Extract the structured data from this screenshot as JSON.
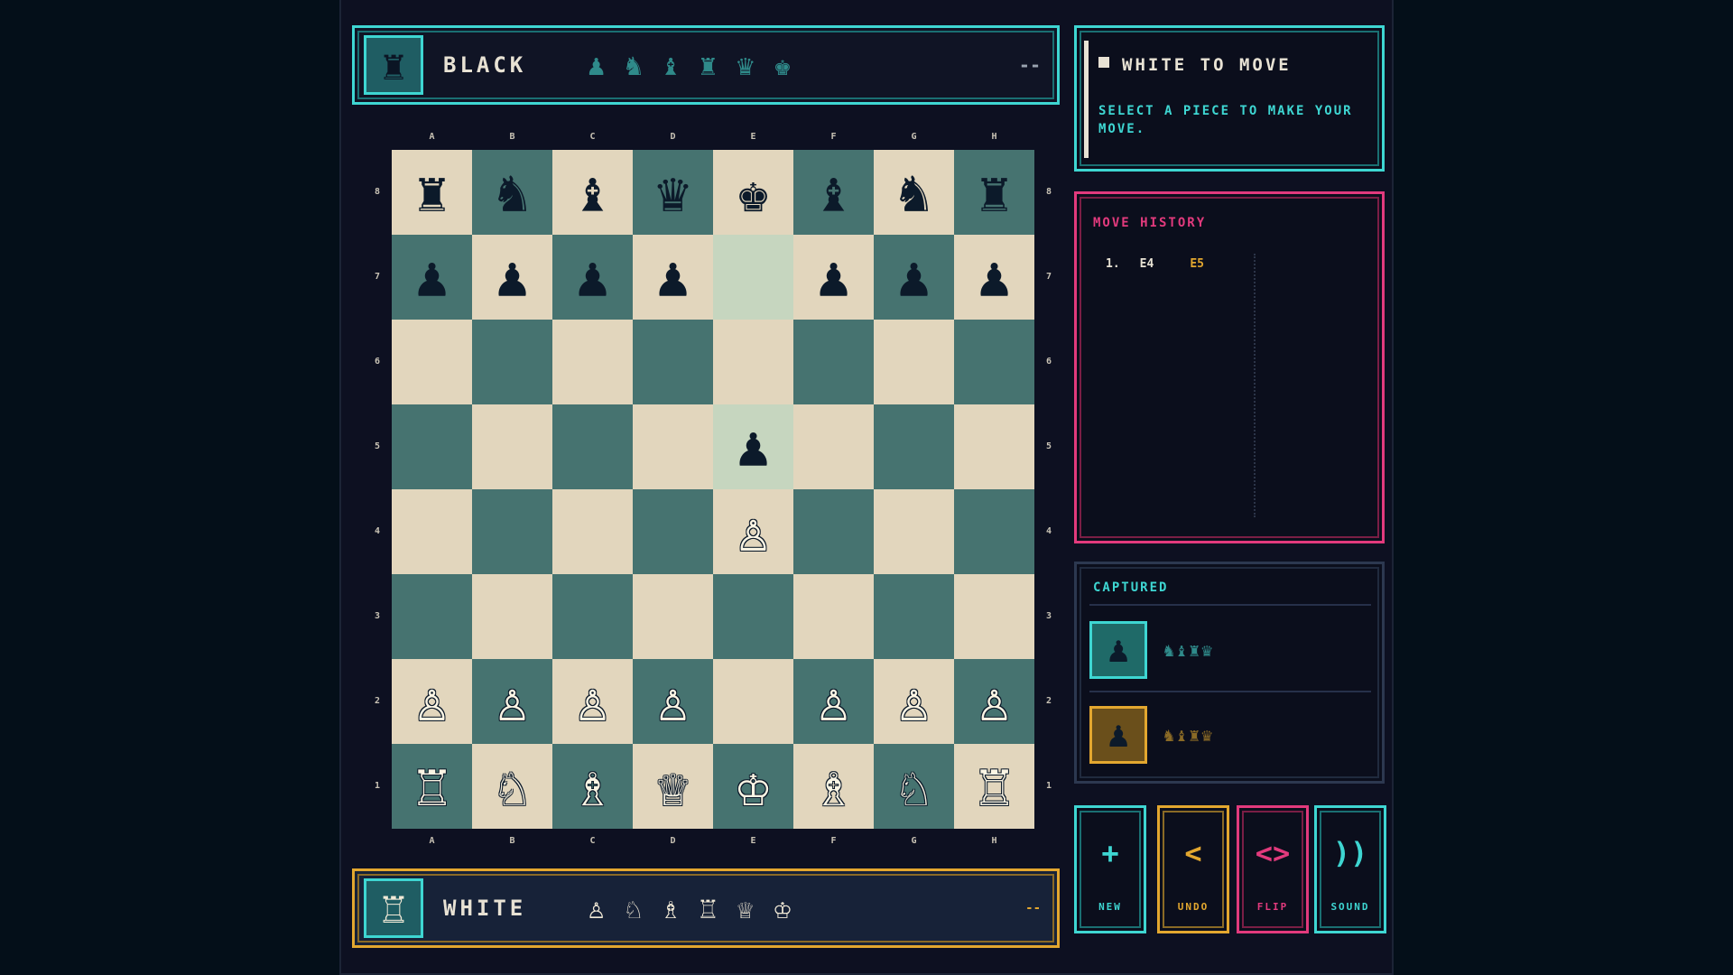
{
  "colors": {
    "teal": "#3ed6d2",
    "gold": "#e3a72f",
    "pink": "#e23a7d",
    "light_square": "#e2d6bd",
    "dark_square": "#467370",
    "highlight_square": "#c6d6bf"
  },
  "players": {
    "black": {
      "name": "BLACK",
      "avatar_glyph": "♜",
      "avatar_icon": "rook-icon",
      "pieces": [
        "♟",
        "♞",
        "♝",
        "♜",
        "♛",
        "♚"
      ],
      "timer": "--"
    },
    "white": {
      "name": "WHITE",
      "avatar_glyph": "♖",
      "avatar_icon": "rook-icon",
      "pieces": [
        "♙",
        "♘",
        "♗",
        "♖",
        "♕",
        "♔"
      ],
      "timer": "--"
    }
  },
  "board": {
    "files": [
      "A",
      "B",
      "C",
      "D",
      "E",
      "F",
      "G",
      "H"
    ],
    "ranks": [
      "8",
      "7",
      "6",
      "5",
      "4",
      "3",
      "2",
      "1"
    ],
    "rows": [
      [
        "br",
        "bn",
        "bb",
        "bq",
        "bk",
        "bb",
        "bn",
        "br"
      ],
      [
        "bp",
        "bp",
        "bp",
        "bp",
        "",
        "bp",
        "bp",
        "bp"
      ],
      [
        "",
        "",
        "",
        "",
        "",
        "",
        "",
        ""
      ],
      [
        "",
        "",
        "",
        "",
        "bp",
        "",
        "",
        ""
      ],
      [
        "",
        "",
        "",
        "",
        "wp",
        "",
        "",
        ""
      ],
      [
        "",
        "",
        "",
        "",
        "",
        "",
        "",
        ""
      ],
      [
        "wp",
        "wp",
        "wp",
        "wp",
        "",
        "wp",
        "wp",
        "wp"
      ],
      [
        "wr",
        "wn",
        "wb",
        "wq",
        "wk",
        "wb",
        "wn",
        "wr"
      ]
    ],
    "highlighted": [
      "e7",
      "e5"
    ]
  },
  "status": {
    "title": "WHITE TO MOVE",
    "message": "SELECT A PIECE TO MAKE YOUR MOVE."
  },
  "history": {
    "title": "MOVE HISTORY",
    "moves": [
      {
        "number": "1.",
        "white": "E4",
        "black": "E5"
      }
    ]
  },
  "captured": {
    "title": "CAPTURED",
    "by_white": {
      "icon_glyph": "♟",
      "pieces": "♞♝♜♛"
    },
    "by_black": {
      "icon_glyph": "♟",
      "pieces": "♞♝♜♛"
    }
  },
  "actions": {
    "new": {
      "icon": "+",
      "label": "NEW"
    },
    "undo": {
      "icon": "<",
      "label": "UNDO"
    },
    "flip": {
      "icon": "<>",
      "label": "FLIP"
    },
    "sound": {
      "icon": "))",
      "label": "SOUND"
    }
  }
}
